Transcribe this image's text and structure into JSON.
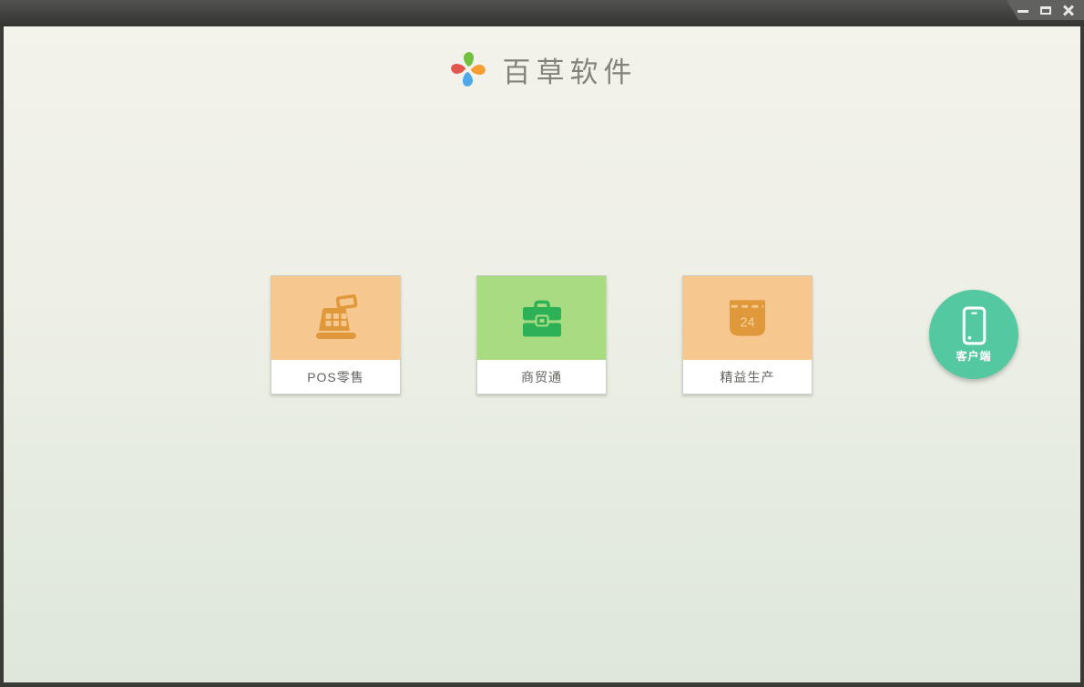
{
  "window": {
    "controls": {
      "minimize": "minimize",
      "maximize": "maximize",
      "close": "close"
    },
    "frame_color": "#3a3a37",
    "titlebar_color": "#444442",
    "controls_panel_color": "#61615f"
  },
  "header": {
    "app_name": "百草软件"
  },
  "logo": {
    "name": "pinwheel-logo",
    "petal_colors": {
      "top": "#72c13e",
      "right": "#f39d33",
      "bottom": "#4ea9ea",
      "left": "#e2574d"
    }
  },
  "products": [
    {
      "label": "POS零售",
      "icon": "cash-register-icon",
      "tile_color": "#f6c78e",
      "icon_color": "#e0993a"
    },
    {
      "label": "商贸通",
      "icon": "briefcase-icon",
      "tile_color": "#a9db82",
      "icon_color": "#2db157"
    },
    {
      "label": "精益生产",
      "icon": "calendar-icon",
      "tile_color": "#f6c78e",
      "icon_color": "#e0993a",
      "calendar_day": "24"
    }
  ],
  "client_button": {
    "label": "客户端",
    "icon": "smartphone-icon",
    "color": "#53c8a1"
  },
  "background": {
    "gradient_top": "#f3f2eb",
    "gradient_bottom": "#dee7da"
  }
}
